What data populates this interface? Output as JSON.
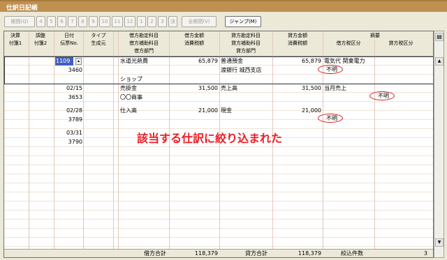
{
  "window": {
    "title": "仕訳日記帳"
  },
  "toolbar": {
    "period": "期間(Q)",
    "months": [
      "4",
      "5",
      "6",
      "7",
      "8",
      "9",
      "10",
      "11",
      "12",
      "1",
      "2",
      "3",
      "決"
    ],
    "all_period": "全期間(V)",
    "jump": "ジャンプ(M)"
  },
  "header": {
    "row1": [
      "決算",
      "調整",
      "日付",
      "タイプ",
      "借方勘定科目",
      "借方金額",
      "貸方勘定科目",
      "貸方金額",
      "摘要"
    ],
    "row2": [
      "付箋1",
      "付箋2",
      "伝票No.",
      "生成元",
      "借方補助科目",
      "消費税額",
      "貸方補助科目",
      "消費税額",
      "借方税区分",
      "貸方税区分"
    ],
    "row3": [
      "借方部門",
      "貸方部門"
    ]
  },
  "entries": [
    {
      "date": "1109",
      "no": "3460",
      "debit_account": "水道光熱費",
      "debit_amount": "65,879",
      "debit_sub": "",
      "debit_dept": "ショップ",
      "credit_account": "普通預金",
      "credit_sub": "渡銀行 城西支店",
      "credit_amount": "65,879",
      "memo": "電気代 関東電力",
      "debit_tax": "不明",
      "credit_tax": ""
    },
    {
      "date": "02/15",
      "no": "3653",
      "debit_account": "売掛金",
      "debit_amount": "31,500",
      "debit_sub": "〇〇商事",
      "debit_dept": "",
      "credit_account": "売上高",
      "credit_sub": "",
      "credit_amount": "31,500",
      "memo": "当月売上",
      "debit_tax": "",
      "credit_tax": "不明"
    },
    {
      "date": "02/28",
      "no": "3789",
      "debit_account": "仕入高",
      "debit_amount": "21,000",
      "debit_sub": "",
      "debit_dept": "",
      "credit_account": "現金",
      "credit_sub": "",
      "credit_amount": "21,000",
      "memo": "",
      "debit_tax": "不明",
      "credit_tax": ""
    },
    {
      "date": "03/31",
      "no": "3790",
      "debit_account": "",
      "debit_amount": "",
      "debit_sub": "",
      "debit_dept": "",
      "credit_account": "",
      "credit_sub": "",
      "credit_amount": "",
      "memo": "",
      "debit_tax": "",
      "credit_tax": ""
    }
  ],
  "callout": "該当する仕訳に絞り込まれた",
  "footer": {
    "debit_total_label": "借方合計",
    "debit_total": "118,379",
    "credit_total_label": "貸方合計",
    "credit_total": "118,379",
    "count_label": "絞込件数",
    "count": "3"
  }
}
